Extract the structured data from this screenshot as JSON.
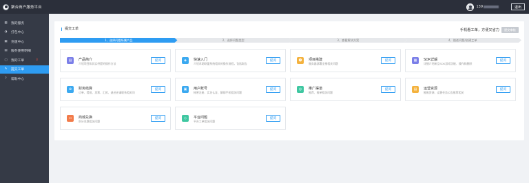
{
  "app": {
    "title": "聚合商户服务平台"
  },
  "header": {
    "phone_prefix": "139",
    "logout_label": "退出"
  },
  "sidebar": {
    "items": [
      {
        "label": "我的服务",
        "icon": "grid-icon",
        "glyph": "▦",
        "active": false,
        "badge": ""
      },
      {
        "label": "打包中心",
        "icon": "package-icon",
        "glyph": "◑",
        "active": false,
        "badge": ""
      },
      {
        "label": "充值中心",
        "icon": "wallet-icon",
        "glyph": "▣",
        "active": false,
        "badge": ""
      },
      {
        "label": "服务使用明细",
        "icon": "list-icon",
        "glyph": "▤",
        "active": false,
        "badge": ""
      },
      {
        "label": "我的工单",
        "icon": "ticket-icon",
        "glyph": "▢",
        "active": false,
        "badge": "3"
      },
      {
        "label": "提交工单",
        "icon": "edit-icon",
        "glyph": "✎",
        "active": true,
        "badge": ""
      },
      {
        "label": "帮助中心",
        "icon": "help-icon",
        "glyph": "?",
        "active": false,
        "badge": ""
      }
    ]
  },
  "panel": {
    "title": "提交工单",
    "hint": "手机看工单，方便又省力",
    "next_label": "提交审核"
  },
  "steps": [
    {
      "label": "1、选择问题所属产品",
      "active": true
    },
    {
      "label": "2、选择问题类型",
      "active": false
    },
    {
      "label": "3、查看解决方案",
      "active": false
    },
    {
      "label": "4、描述问题/创建工单",
      "active": false
    }
  ],
  "cards": [
    {
      "title": "产品简介",
      "desc": "介绍项目和其实供提的操作方法",
      "icon": "product-icon",
      "glyph": "▤",
      "color": "#7b7fe8",
      "button": "提问"
    },
    {
      "title": "快速入门",
      "desc": "介绍求助联盟系统相关的操作流程，包括取告",
      "icon": "rocket-icon",
      "glyph": "◈",
      "color": "#3ba9f0",
      "button": "提问"
    },
    {
      "title": "项目搭建",
      "desc": "服务器部署全接相关问题",
      "icon": "user-build-icon",
      "glyph": "☻",
      "color": "#f4b23e",
      "button": "提问"
    },
    {
      "title": "SDK详解",
      "desc": "详细介绍新品SDK游戏功能、操作和删除",
      "icon": "sdk-icon",
      "glyph": "▦",
      "color": "#7b7fe8",
      "button": "提问"
    },
    {
      "title": "财务结算",
      "desc": "订单、提现、发票、汇款、退还还请联系相关问",
      "icon": "finance-icon",
      "glyph": "⊕",
      "color": "#3ba9f0",
      "button": "提问"
    },
    {
      "title": "用户账号",
      "desc": "帐密注册、实名认证、解绑手机相关问题",
      "icon": "account-icon",
      "glyph": "▣",
      "color": "#3ba9f0",
      "button": "提问"
    },
    {
      "title": "推广渠道",
      "desc": "推荐、推单相关问题",
      "icon": "promotion-icon",
      "glyph": "◎",
      "color": "#3fc7a1",
      "button": "提问"
    },
    {
      "title": "运营资源",
      "desc": "推推资源、运营任务公告推荐相关",
      "icon": "resource-icon",
      "glyph": "▤",
      "color": "#f4b23e",
      "button": "提问"
    },
    {
      "title": "商城兑换",
      "desc": "积分兑换相关问题",
      "icon": "shop-icon",
      "glyph": "▭",
      "color": "#f27b4a",
      "button": "提问"
    },
    {
      "title": "平台问题",
      "desc": "平台工单相关问题",
      "icon": "platform-icon",
      "glyph": "◇",
      "color": "#3fc7a1",
      "button": "提问"
    }
  ]
}
